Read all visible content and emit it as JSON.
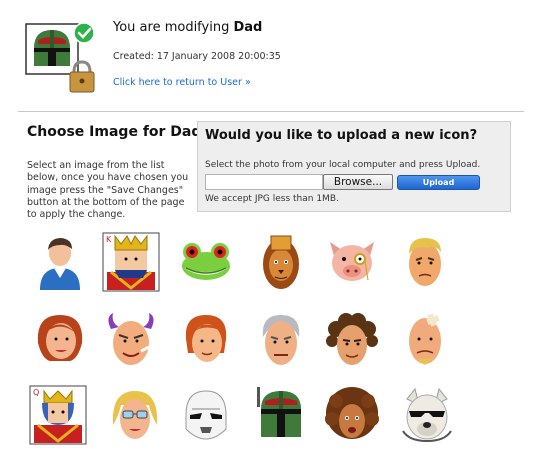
{
  "header": {
    "title_prefix": "You are modifying ",
    "title_name": "Dad",
    "created": "Created: 17 January 2008 20:00:35",
    "back_link": "Click here to return to User »"
  },
  "chooser": {
    "title": "Choose Image for Dad",
    "instructions": "Select an image from the list below, once you have chosen you image press the \"Save Changes\" button at the bottom of the page to apply the change."
  },
  "upload": {
    "title": "Would you like to upload a new icon?",
    "instructions": "Select the photo from your local computer and press Upload.",
    "browse_label": "Browse...",
    "upload_label": "Upload",
    "note": "We accept JPG less than 1MB."
  },
  "avatars": [
    "user-icon",
    "king-of-hearts-icon",
    "frog-icon",
    "lion-icon",
    "pig-icon",
    "blonde-man-icon",
    "woman-redhead-icon",
    "devil-icon",
    "redhead-girl-icon",
    "grey-haired-man-icon",
    "curly-man-icon",
    "injured-man-icon",
    "queen-card-icon",
    "blonde-woman-icon",
    "stormtrooper-icon",
    "boba-fett-icon",
    "afro-woman-icon",
    "cool-dog-icon"
  ],
  "colors": {
    "link": "#1a6bd6",
    "upload_button": "#2c74dc",
    "panel_bg": "#eeeeee"
  }
}
